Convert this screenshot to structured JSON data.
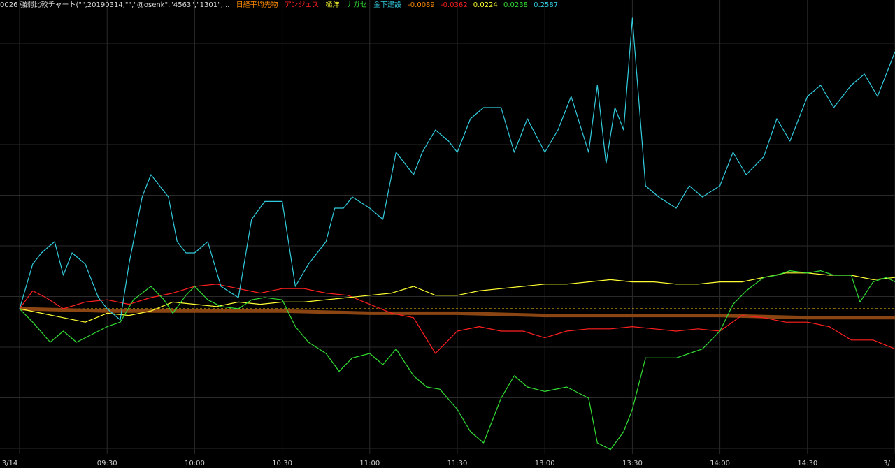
{
  "header": {
    "title": "0026 強弱比較チャート(\"\",20190314,\"\",\"@osenk\",\"4563\",\"1301\",...",
    "series_labels": [
      "日経平均先物",
      "アンジェス",
      "極洋",
      "ナガセ",
      "金下建設"
    ],
    "series_colors": [
      "#ff8c00",
      "#ff2020",
      "#ffff33",
      "#33dd33",
      "#33ccdd"
    ],
    "values": [
      "-0.0089",
      "-0.0362",
      "0.0224",
      "0.0238",
      "0.2587"
    ]
  },
  "colors": {
    "background": "#000000",
    "grid": "#2a2a2a",
    "baseline": "#ffcc00"
  },
  "chart_data": {
    "type": "line",
    "x_tick_labels": [
      "3/14",
      "09:30",
      "10:00",
      "10:30",
      "11:00",
      "11:30",
      "13:00",
      "13:30",
      "14:00",
      "14:30",
      "3/"
    ],
    "ylim": [
      -0.065,
      0.135
    ],
    "grid": true,
    "baseline": 0,
    "series": [
      {
        "name": "日経平均先物",
        "color": "#8b4513",
        "x": [
          0,
          2,
          4,
          6,
          8,
          10,
          12,
          14,
          16,
          18,
          19,
          20
        ],
        "values": [
          0,
          -0.001,
          -0.001,
          -0.001,
          -0.002,
          -0.002,
          -0.003,
          -0.003,
          -0.003,
          -0.004,
          -0.004,
          -0.004
        ]
      },
      {
        "name": "アンジェス",
        "color": "#ff2020",
        "x": [
          0,
          0.3,
          0.6,
          1.0,
          1.5,
          2.0,
          2.5,
          3.0,
          3.5,
          4.0,
          4.5,
          5.0,
          5.5,
          6.0,
          6.5,
          7.0,
          7.5,
          8.0,
          8.5,
          9.0,
          9.5,
          10.0,
          10.5,
          11.0,
          11.5,
          12.0,
          12.5,
          13.0,
          13.5,
          14.0,
          14.5,
          15.0,
          15.5,
          16.0,
          16.5,
          17.0,
          17.5,
          18.0,
          18.5,
          19.0,
          19.5,
          20.0
        ],
        "values": [
          0,
          0.008,
          0.005,
          0,
          0.003,
          0.004,
          0.002,
          0.005,
          0.007,
          0.01,
          0.011,
          0.009,
          0.007,
          0.009,
          0.009,
          0.007,
          0.006,
          0.002,
          -0.002,
          -0.004,
          -0.02,
          -0.01,
          -0.008,
          -0.01,
          -0.01,
          -0.013,
          -0.01,
          -0.009,
          -0.009,
          -0.008,
          -0.009,
          -0.01,
          -0.009,
          -0.01,
          -0.003,
          -0.004,
          -0.006,
          -0.006,
          -0.008,
          -0.014,
          -0.014,
          -0.018
        ]
      },
      {
        "name": "極洋",
        "color": "#ffff33",
        "x": [
          0,
          0.5,
          1.0,
          1.5,
          2.0,
          2.5,
          3.0,
          3.5,
          4.0,
          4.5,
          5.0,
          5.5,
          6.0,
          6.5,
          7.0,
          7.5,
          8.0,
          8.5,
          9.0,
          9.5,
          10.0,
          10.5,
          11.0,
          11.5,
          12.0,
          12.5,
          13.0,
          13.5,
          14.0,
          14.5,
          15.0,
          15.5,
          16.0,
          16.5,
          17.0,
          17.5,
          18.0,
          18.5,
          19.0,
          19.5,
          20.0
        ],
        "values": [
          0,
          -0.002,
          -0.004,
          -0.006,
          -0.002,
          -0.003,
          -0.001,
          0.003,
          0.002,
          0.001,
          0.003,
          0.002,
          0.003,
          0.003,
          0.004,
          0.005,
          0.006,
          0.007,
          0.01,
          0.006,
          0.006,
          0.008,
          0.009,
          0.01,
          0.011,
          0.011,
          0.012,
          0.013,
          0.012,
          0.012,
          0.011,
          0.011,
          0.012,
          0.012,
          0.014,
          0.016,
          0.016,
          0.015,
          0.015,
          0.013,
          0.014
        ]
      },
      {
        "name": "ナガセ",
        "color": "#33dd33",
        "x": [
          0,
          0.3,
          0.7,
          1.0,
          1.3,
          1.6,
          2.0,
          2.3,
          2.6,
          3.0,
          3.3,
          3.5,
          3.8,
          4.0,
          4.3,
          4.6,
          5.0,
          5.3,
          5.6,
          6.0,
          6.3,
          6.6,
          7.0,
          7.3,
          7.6,
          8.0,
          8.3,
          8.6,
          9.0,
          9.3,
          9.6,
          10.0,
          10.3,
          10.6,
          11.0,
          11.3,
          11.6,
          12.0,
          12.5,
          13.0,
          13.2,
          13.5,
          13.8,
          14.0,
          14.3,
          14.6,
          15.0,
          15.3,
          15.6,
          16.0,
          16.3,
          16.6,
          17.0,
          17.3,
          17.6,
          18.0,
          18.3,
          18.6,
          19.0,
          19.2,
          19.5,
          19.8,
          20.0
        ],
        "values": [
          0,
          -0.006,
          -0.015,
          -0.01,
          -0.015,
          -0.012,
          -0.008,
          -0.006,
          0.004,
          0.01,
          0.004,
          -0.002,
          0.006,
          0.01,
          0.004,
          0.001,
          0,
          0.004,
          0.005,
          0.004,
          -0.008,
          -0.015,
          -0.02,
          -0.028,
          -0.022,
          -0.02,
          -0.025,
          -0.018,
          -0.03,
          -0.035,
          -0.036,
          -0.045,
          -0.055,
          -0.06,
          -0.04,
          -0.03,
          -0.035,
          -0.037,
          -0.035,
          -0.04,
          -0.06,
          -0.063,
          -0.055,
          -0.045,
          -0.022,
          -0.022,
          -0.022,
          -0.02,
          -0.018,
          -0.01,
          0.002,
          0.008,
          0.014,
          0.015,
          0.017,
          0.016,
          0.017,
          0.015,
          0.015,
          0.003,
          0.012,
          0.014,
          0.012
        ]
      },
      {
        "name": "金下建設",
        "color": "#33ccdd",
        "x": [
          0,
          0.3,
          0.5,
          0.8,
          1.0,
          1.2,
          1.5,
          1.8,
          2.0,
          2.3,
          2.5,
          2.8,
          3.0,
          3.2,
          3.4,
          3.6,
          3.8,
          4.0,
          4.3,
          4.6,
          5.0,
          5.3,
          5.6,
          6.0,
          6.3,
          6.6,
          7.0,
          7.2,
          7.4,
          7.6,
          8.0,
          8.3,
          8.6,
          9.0,
          9.2,
          9.5,
          9.8,
          10.0,
          10.3,
          10.6,
          11.0,
          11.3,
          11.6,
          12.0,
          12.3,
          12.6,
          13.0,
          13.2,
          13.4,
          13.6,
          13.8,
          14.0,
          14.3,
          14.6,
          15.0,
          15.3,
          15.6,
          16.0,
          16.3,
          16.6,
          17.0,
          17.3,
          17.6,
          18.0,
          18.3,
          18.6,
          19.0,
          19.3,
          19.6,
          20.0
        ],
        "values": [
          0,
          0.02,
          0.025,
          0.03,
          0.015,
          0.025,
          0.02,
          0.005,
          0,
          -0.005,
          0.02,
          0.05,
          0.06,
          0.055,
          0.05,
          0.03,
          0.025,
          0.025,
          0.03,
          0.01,
          0.005,
          0.04,
          0.048,
          0.048,
          0.01,
          0.02,
          0.03,
          0.045,
          0.045,
          0.05,
          0.045,
          0.04,
          0.07,
          0.06,
          0.07,
          0.08,
          0.075,
          0.07,
          0.085,
          0.09,
          0.09,
          0.07,
          0.085,
          0.07,
          0.08,
          0.095,
          0.07,
          0.1,
          0.065,
          0.09,
          0.08,
          0.13,
          0.055,
          0.05,
          0.045,
          0.055,
          0.05,
          0.055,
          0.07,
          0.06,
          0.068,
          0.085,
          0.075,
          0.095,
          0.1,
          0.09,
          0.1,
          0.105,
          0.095,
          0.115
        ]
      }
    ]
  }
}
